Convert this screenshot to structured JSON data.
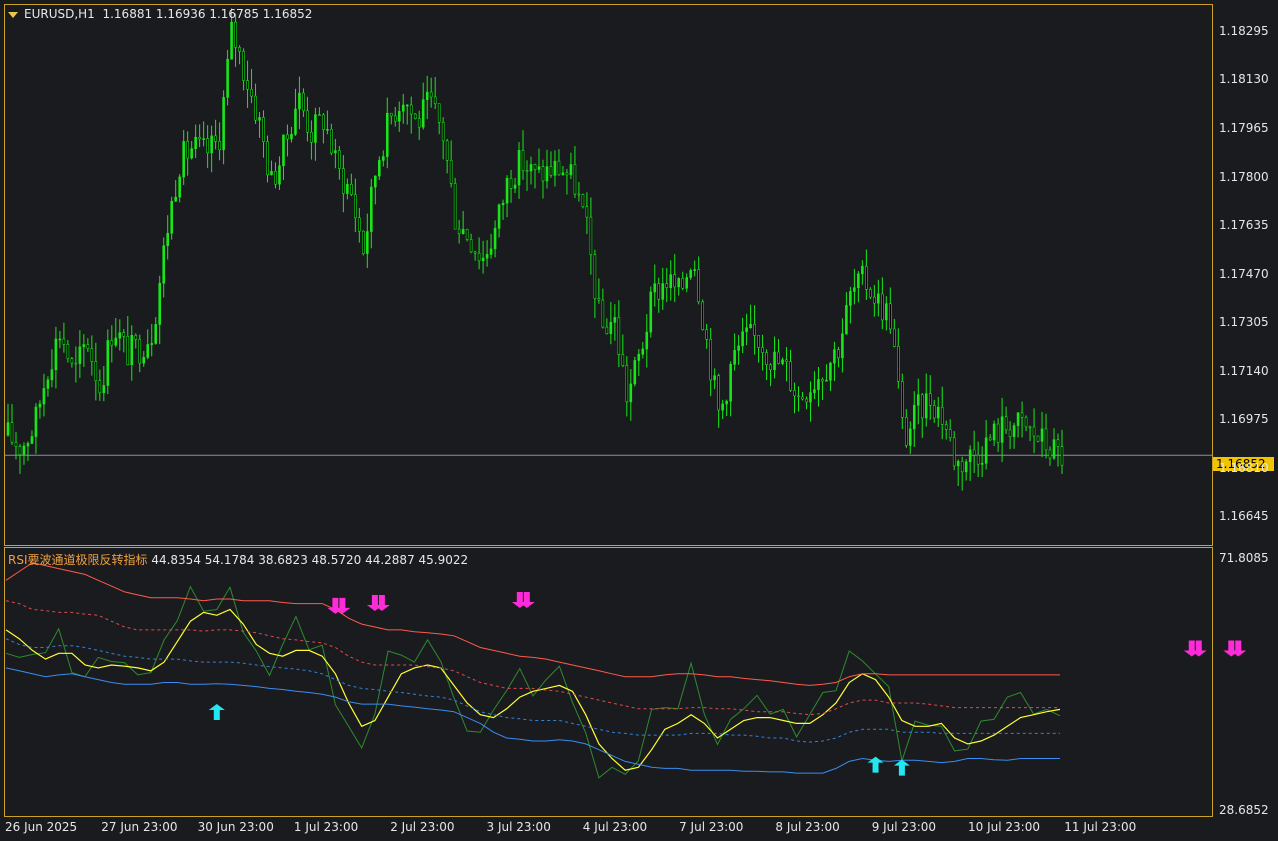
{
  "header": {
    "symbol": "EURUSD,H1",
    "ohlc": "1.16881 1.16936 1.16785 1.16852"
  },
  "indicator": {
    "name": "RSI要波通道极限反转指标",
    "values": "44.8354 54.1784 38.6823 48.5720 44.2887 45.9022"
  },
  "colors": {
    "bull": "#19e619",
    "background": "#1a1b1f",
    "border": "#c9a227",
    "rsi": "#2e8b2e",
    "smooth": "#ffff33",
    "upper_band": "#ff5a4a",
    "mid_upper": "#e04a4a",
    "mid_lower": "#2f84d8",
    "lower_band": "#3a8cf0",
    "arrow_down": "#ff2ad8",
    "arrow_up": "#22e6f0",
    "price_badge": "#f0c400"
  },
  "chart_data": [
    {
      "type": "candlestick",
      "title": "EURUSD,H1",
      "ohlc_current": [
        1.16881,
        1.16936,
        1.16785,
        1.16852
      ],
      "current_price": "1.16852",
      "ylim": [
        1.1655,
        1.1838
      ],
      "y_ticks": [
        "1.18295",
        "1.18130",
        "1.17965",
        "1.17800",
        "1.17635",
        "1.17470",
        "1.17305",
        "1.17140",
        "1.16975",
        "1.16810",
        "1.16645"
      ],
      "x_ticks": [
        "26 Jun 2025",
        "27 Jun 23:00",
        "30 Jun 23:00",
        "1 Jul 23:00",
        "2 Jul 23:00",
        "3 Jul 23:00",
        "4 Jul 23:00",
        "7 Jul 23:00",
        "8 Jul 23:00",
        "9 Jul 23:00",
        "10 Jul 23:00",
        "11 Jul 23:00"
      ],
      "close_path": [
        1.1692,
        1.1688,
        1.1695,
        1.1715,
        1.1728,
        1.1712,
        1.1725,
        1.1708,
        1.173,
        1.172,
        1.1722,
        1.1728,
        1.176,
        1.1785,
        1.179,
        1.1788,
        1.1792,
        1.183,
        1.1815,
        1.18,
        1.1778,
        1.179,
        1.1808,
        1.1795,
        1.18,
        1.1782,
        1.1775,
        1.1755,
        1.1785,
        1.18,
        1.1808,
        1.1798,
        1.1805,
        1.1795,
        1.1765,
        1.176,
        1.1752,
        1.1762,
        1.178,
        1.1785,
        1.178,
        1.1782,
        1.1783,
        1.1778,
        1.176,
        1.1728,
        1.1732,
        1.1705,
        1.172,
        1.174,
        1.1745,
        1.174,
        1.1755,
        1.1725,
        1.1698,
        1.1718,
        1.1725,
        1.1725,
        1.1718,
        1.1715,
        1.1705,
        1.171,
        1.1715,
        1.1722,
        1.174,
        1.1745,
        1.1738,
        1.1732,
        1.169,
        1.17,
        1.1705,
        1.1698,
        1.1682,
        1.1685,
        1.1688,
        1.1693,
        1.1696,
        1.1695,
        1.1692,
        1.1688,
        1.1685
      ]
    },
    {
      "type": "line",
      "title": "RSI要波通道极限反转指标",
      "ylim": [
        28.6852,
        71.8085
      ],
      "y_ticks": [
        "71.8085",
        "28.6852"
      ],
      "current_values": [
        44.8354,
        54.1784,
        38.6823,
        48.572,
        44.2887,
        45.9022
      ],
      "series": [
        {
          "key": "rsi",
          "values": [
            55.5,
            54.8,
            53.5,
            56.5,
            58.8,
            54.0,
            51.5,
            53.0,
            55.0,
            53.0,
            53.6,
            52.2,
            56.0,
            62.0,
            66.0,
            64.5,
            63.0,
            65.0,
            60.0,
            55.0,
            53.5,
            57.0,
            60.0,
            57.0,
            56.0,
            48.5,
            43.0,
            37.5,
            46.0,
            55.0,
            57.0,
            54.0,
            56.0,
            55.0,
            47.0,
            44.0,
            42.0,
            44.0,
            50.0,
            52.0,
            50.0,
            51.0,
            51.5,
            48.0,
            41.0,
            36.0,
            36.0,
            33.0,
            38.0,
            45.0,
            48.0,
            46.0,
            52.0,
            46.0,
            39.0,
            46.0,
            46.0,
            46.5,
            46.0,
            45.0,
            43.0,
            45.0,
            47.0,
            50.0,
            55.0,
            56.0,
            52.0,
            48.0,
            38.0,
            43.0,
            45.0,
            43.0,
            37.0,
            40.0,
            43.0,
            46.0,
            48.0,
            47.0,
            46.0,
            45.0,
            44.8
          ]
        },
        {
          "key": "smooth",
          "values": [
            59.5,
            58.0,
            56.0,
            54.5,
            55.5,
            55.5,
            53.5,
            53.0,
            53.5,
            53.3,
            53.0,
            52.5,
            54.0,
            57.5,
            61.0,
            62.5,
            62.0,
            63.0,
            60.5,
            57.0,
            55.5,
            55.0,
            56.0,
            56.0,
            55.0,
            52.0,
            47.0,
            43.0,
            44.0,
            48.0,
            52.0,
            53.0,
            53.5,
            53.0,
            50.0,
            47.0,
            45.0,
            44.5,
            46.0,
            48.0,
            49.0,
            49.5,
            50.0,
            49.0,
            45.0,
            40.0,
            37.5,
            35.5,
            36.0,
            39.0,
            42.5,
            43.5,
            45.0,
            43.5,
            41.0,
            42.5,
            44.0,
            44.5,
            44.5,
            44.0,
            43.5,
            43.5,
            45.0,
            47.0,
            50.5,
            52.0,
            51.0,
            48.0,
            44.0,
            43.0,
            43.0,
            43.5,
            41.0,
            40.0,
            40.5,
            41.5,
            43.0,
            44.5,
            45.0,
            45.5,
            45.9
          ]
        },
        {
          "key": "upper_band",
          "values": [
            68.0,
            69.5,
            71.0,
            70.5,
            70.0,
            69.5,
            69.0,
            68.0,
            67.0,
            66.0,
            65.5,
            65.0,
            65.0,
            65.0,
            64.8,
            64.5,
            64.8,
            64.8,
            64.5,
            64.5,
            64.5,
            64.2,
            64.0,
            64.0,
            64.0,
            63.0,
            61.5,
            60.5,
            60.0,
            59.5,
            59.5,
            59.2,
            59.0,
            58.8,
            58.5,
            57.5,
            56.5,
            56.0,
            55.5,
            55.0,
            54.8,
            54.5,
            54.0,
            53.5,
            53.0,
            52.5,
            52.0,
            51.5,
            51.5,
            51.5,
            51.8,
            52.0,
            52.0,
            51.8,
            51.5,
            51.5,
            51.2,
            51.0,
            50.8,
            50.5,
            50.2,
            50.0,
            50.2,
            50.5,
            51.5,
            52.0,
            52.0,
            51.8,
            51.8,
            51.8,
            51.8,
            51.8,
            51.8,
            51.8,
            51.8,
            51.8,
            51.8,
            51.8,
            51.8,
            51.8,
            51.8
          ]
        },
        {
          "key": "mid_upper",
          "values": [
            64.5,
            64.0,
            63.0,
            62.8,
            62.5,
            62.5,
            62.2,
            62.0,
            61.0,
            60.0,
            59.5,
            59.5,
            59.5,
            59.5,
            59.5,
            59.3,
            59.5,
            59.5,
            59.3,
            59.0,
            58.5,
            58.0,
            57.8,
            57.5,
            57.3,
            56.5,
            55.0,
            54.0,
            53.5,
            53.5,
            53.5,
            53.5,
            53.2,
            53.0,
            52.5,
            51.5,
            50.5,
            50.0,
            49.5,
            49.5,
            49.5,
            49.2,
            49.0,
            48.5,
            48.0,
            47.5,
            47.0,
            46.5,
            46.0,
            46.0,
            46.0,
            46.0,
            46.2,
            46.2,
            46.0,
            46.0,
            45.8,
            45.5,
            45.5,
            45.5,
            45.2,
            45.0,
            45.2,
            46.0,
            47.0,
            47.5,
            47.5,
            47.0,
            47.0,
            47.0,
            46.8,
            46.5,
            46.2,
            46.2,
            46.2,
            46.2,
            46.2,
            46.2,
            46.2,
            46.2,
            46.2
          ]
        },
        {
          "key": "mid_lower",
          "values": [
            58.0,
            57.0,
            56.5,
            56.5,
            56.8,
            56.8,
            56.5,
            56.0,
            55.5,
            55.0,
            54.8,
            54.5,
            54.5,
            54.5,
            54.2,
            54.0,
            54.0,
            54.0,
            53.8,
            53.5,
            53.2,
            53.0,
            52.8,
            52.5,
            52.0,
            51.0,
            50.0,
            49.5,
            49.3,
            49.0,
            48.8,
            48.5,
            48.2,
            48.0,
            47.5,
            46.5,
            45.5,
            45.0,
            44.5,
            44.3,
            44.0,
            44.0,
            44.0,
            43.5,
            43.0,
            42.5,
            42.0,
            41.8,
            41.5,
            41.5,
            41.5,
            41.5,
            41.8,
            41.8,
            41.8,
            41.5,
            41.5,
            41.3,
            41.0,
            41.0,
            40.5,
            40.3,
            40.5,
            41.0,
            42.0,
            42.5,
            42.5,
            42.5,
            42.0,
            42.0,
            42.0,
            41.8,
            41.8,
            41.8,
            41.8,
            41.8,
            41.8,
            41.8,
            41.8,
            41.8,
            41.8
          ]
        },
        {
          "key": "lower_band",
          "values": [
            53.0,
            52.5,
            52.0,
            51.5,
            51.8,
            52.0,
            51.5,
            51.0,
            50.5,
            50.2,
            50.2,
            50.2,
            50.5,
            50.5,
            50.2,
            50.2,
            50.3,
            50.2,
            50.0,
            49.8,
            49.5,
            49.3,
            49.0,
            48.8,
            48.5,
            48.0,
            47.2,
            46.8,
            46.8,
            46.8,
            46.5,
            46.3,
            46.0,
            45.8,
            45.5,
            44.5,
            43.5,
            42.0,
            41.0,
            40.8,
            40.5,
            40.5,
            40.7,
            40.5,
            40.0,
            39.0,
            38.0,
            37.0,
            36.5,
            36.0,
            35.8,
            35.8,
            35.5,
            35.5,
            35.5,
            35.5,
            35.3,
            35.3,
            35.2,
            35.2,
            35.0,
            35.0,
            35.0,
            35.8,
            37.0,
            37.5,
            37.2,
            37.0,
            37.2,
            37.2,
            37.0,
            36.8,
            37.0,
            37.5,
            37.5,
            37.3,
            37.2,
            37.5,
            37.5,
            37.5,
            37.5
          ]
        }
      ],
      "arrows_down": [
        [
          25,
          64.3
        ],
        [
          28,
          64.8
        ],
        [
          39,
          65.3
        ],
        [
          90,
          57.0
        ],
        [
          93,
          57.0
        ]
      ],
      "arrows_up": [
        [
          16,
          47.5
        ],
        [
          66,
          38.5
        ],
        [
          68,
          38.0
        ]
      ]
    }
  ]
}
